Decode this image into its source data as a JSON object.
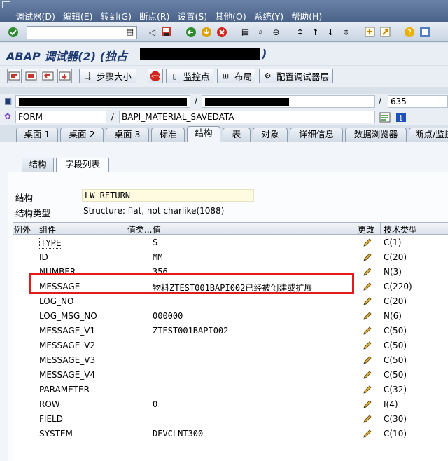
{
  "menubar": {
    "items": [
      "调试器(D)",
      "编辑(E)",
      "转到(G)",
      "断点(R)",
      "设置(S)",
      "其他(O)",
      "系统(Y)",
      "帮助(H)"
    ]
  },
  "toolbar": {
    "command_value": ""
  },
  "title": {
    "text": "ABAP 调试器(2) (独占",
    "suffix": ")"
  },
  "app_toolbar": {
    "step_size": "步骤大小",
    "watchpoint": "监控点",
    "layout": "布局",
    "config_layer": "配置调试器层"
  },
  "context": {
    "line_number": "635",
    "event_type": "FORM",
    "event_name": "BAPI_MATERIAL_SAVEDATA"
  },
  "tabs": [
    "桌面 1",
    "桌面 2",
    "桌面 3",
    "标准",
    "结构",
    "表",
    "对象",
    "详细信息",
    "数据浏览器",
    "断点/监控"
  ],
  "subtabs": [
    "结构",
    "字段列表"
  ],
  "structure": {
    "label": "结构",
    "name": "LW_RETURN",
    "type_label": "结构类型",
    "type_value": "Structure: flat, not charlike(1088)"
  },
  "grid": {
    "headers": [
      "例外",
      "组件",
      "值类...",
      "值",
      "更改",
      "技术类型"
    ],
    "rows": [
      {
        "component": "TYPE",
        "value": "S",
        "tech": "C(1)"
      },
      {
        "component": "ID",
        "value": "MM",
        "tech": "C(20)"
      },
      {
        "component": "NUMBER",
        "value": "356",
        "tech": "N(3)"
      },
      {
        "component": "MESSAGE",
        "value": "物料ZTEST001BAPI002已经被创建或扩展",
        "tech": "C(220)"
      },
      {
        "component": "LOG_NO",
        "value": "",
        "tech": "C(20)"
      },
      {
        "component": "LOG_MSG_NO",
        "value": "000000",
        "tech": "N(6)"
      },
      {
        "component": "MESSAGE_V1",
        "value": "ZTEST001BAPI002",
        "tech": "C(50)"
      },
      {
        "component": "MESSAGE_V2",
        "value": "",
        "tech": "C(50)"
      },
      {
        "component": "MESSAGE_V3",
        "value": "",
        "tech": "C(50)"
      },
      {
        "component": "MESSAGE_V4",
        "value": "",
        "tech": "C(50)"
      },
      {
        "component": "PARAMETER",
        "value": "",
        "tech": "C(32)"
      },
      {
        "component": "ROW",
        "value": "0",
        "tech": "I(4)"
      },
      {
        "component": "FIELD",
        "value": "",
        "tech": "C(30)"
      },
      {
        "component": "SYSTEM",
        "value": "DEVCLNT300",
        "tech": "C(10)"
      }
    ]
  },
  "colors": {
    "highlight": "#e21a1a",
    "title": "#1e3a73"
  }
}
